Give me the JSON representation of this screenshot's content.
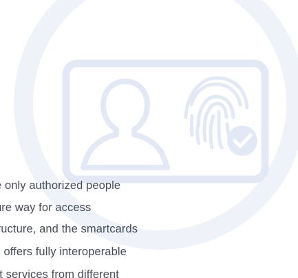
{
  "icons": {
    "background_ring": "circle-ring",
    "card": "id-card-icon",
    "person": "person-silhouette-icon",
    "fingerprint": "fingerprint-icon",
    "check": "check-badge-icon"
  },
  "colors": {
    "background": "#ffffff",
    "ring": "#eef2f9",
    "illustration": "#e3e9f4",
    "text": "#454c56"
  },
  "text_lines": [
    "e only authorized people",
    "ure way for access",
    "tructure, and the smartcards",
    "P offers fully interoperable",
    "nt services from different"
  ]
}
